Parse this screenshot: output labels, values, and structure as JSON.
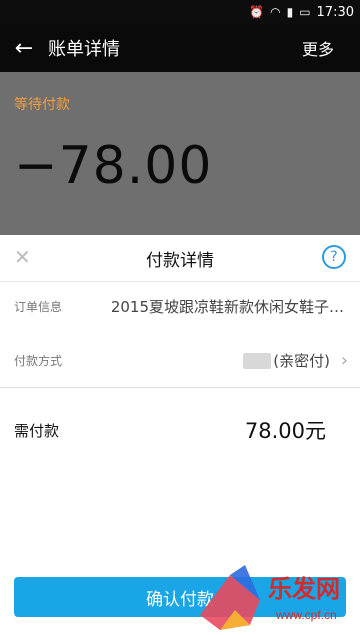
{
  "statusbar": {
    "time": "17:30"
  },
  "appbar": {
    "back_icon": "back-arrow-icon",
    "title": "账单详情",
    "more_label": "更多"
  },
  "bill": {
    "status": "等待付款",
    "amount": "−78.00"
  },
  "sheet": {
    "title": "付款详情",
    "order": {
      "label": "订单信息",
      "value": "2015夏坡跟凉鞋新款休闲女鞋子…"
    },
    "payment": {
      "label": "付款方式",
      "value": "(亲密付)"
    },
    "due": {
      "label": "需付款",
      "value": "78.00元"
    },
    "confirm_label": "确认付款"
  },
  "colors": {
    "accent": "#1aa6e6",
    "status": "#f0a040"
  },
  "watermark": {
    "text": "www.cpf.cn"
  }
}
